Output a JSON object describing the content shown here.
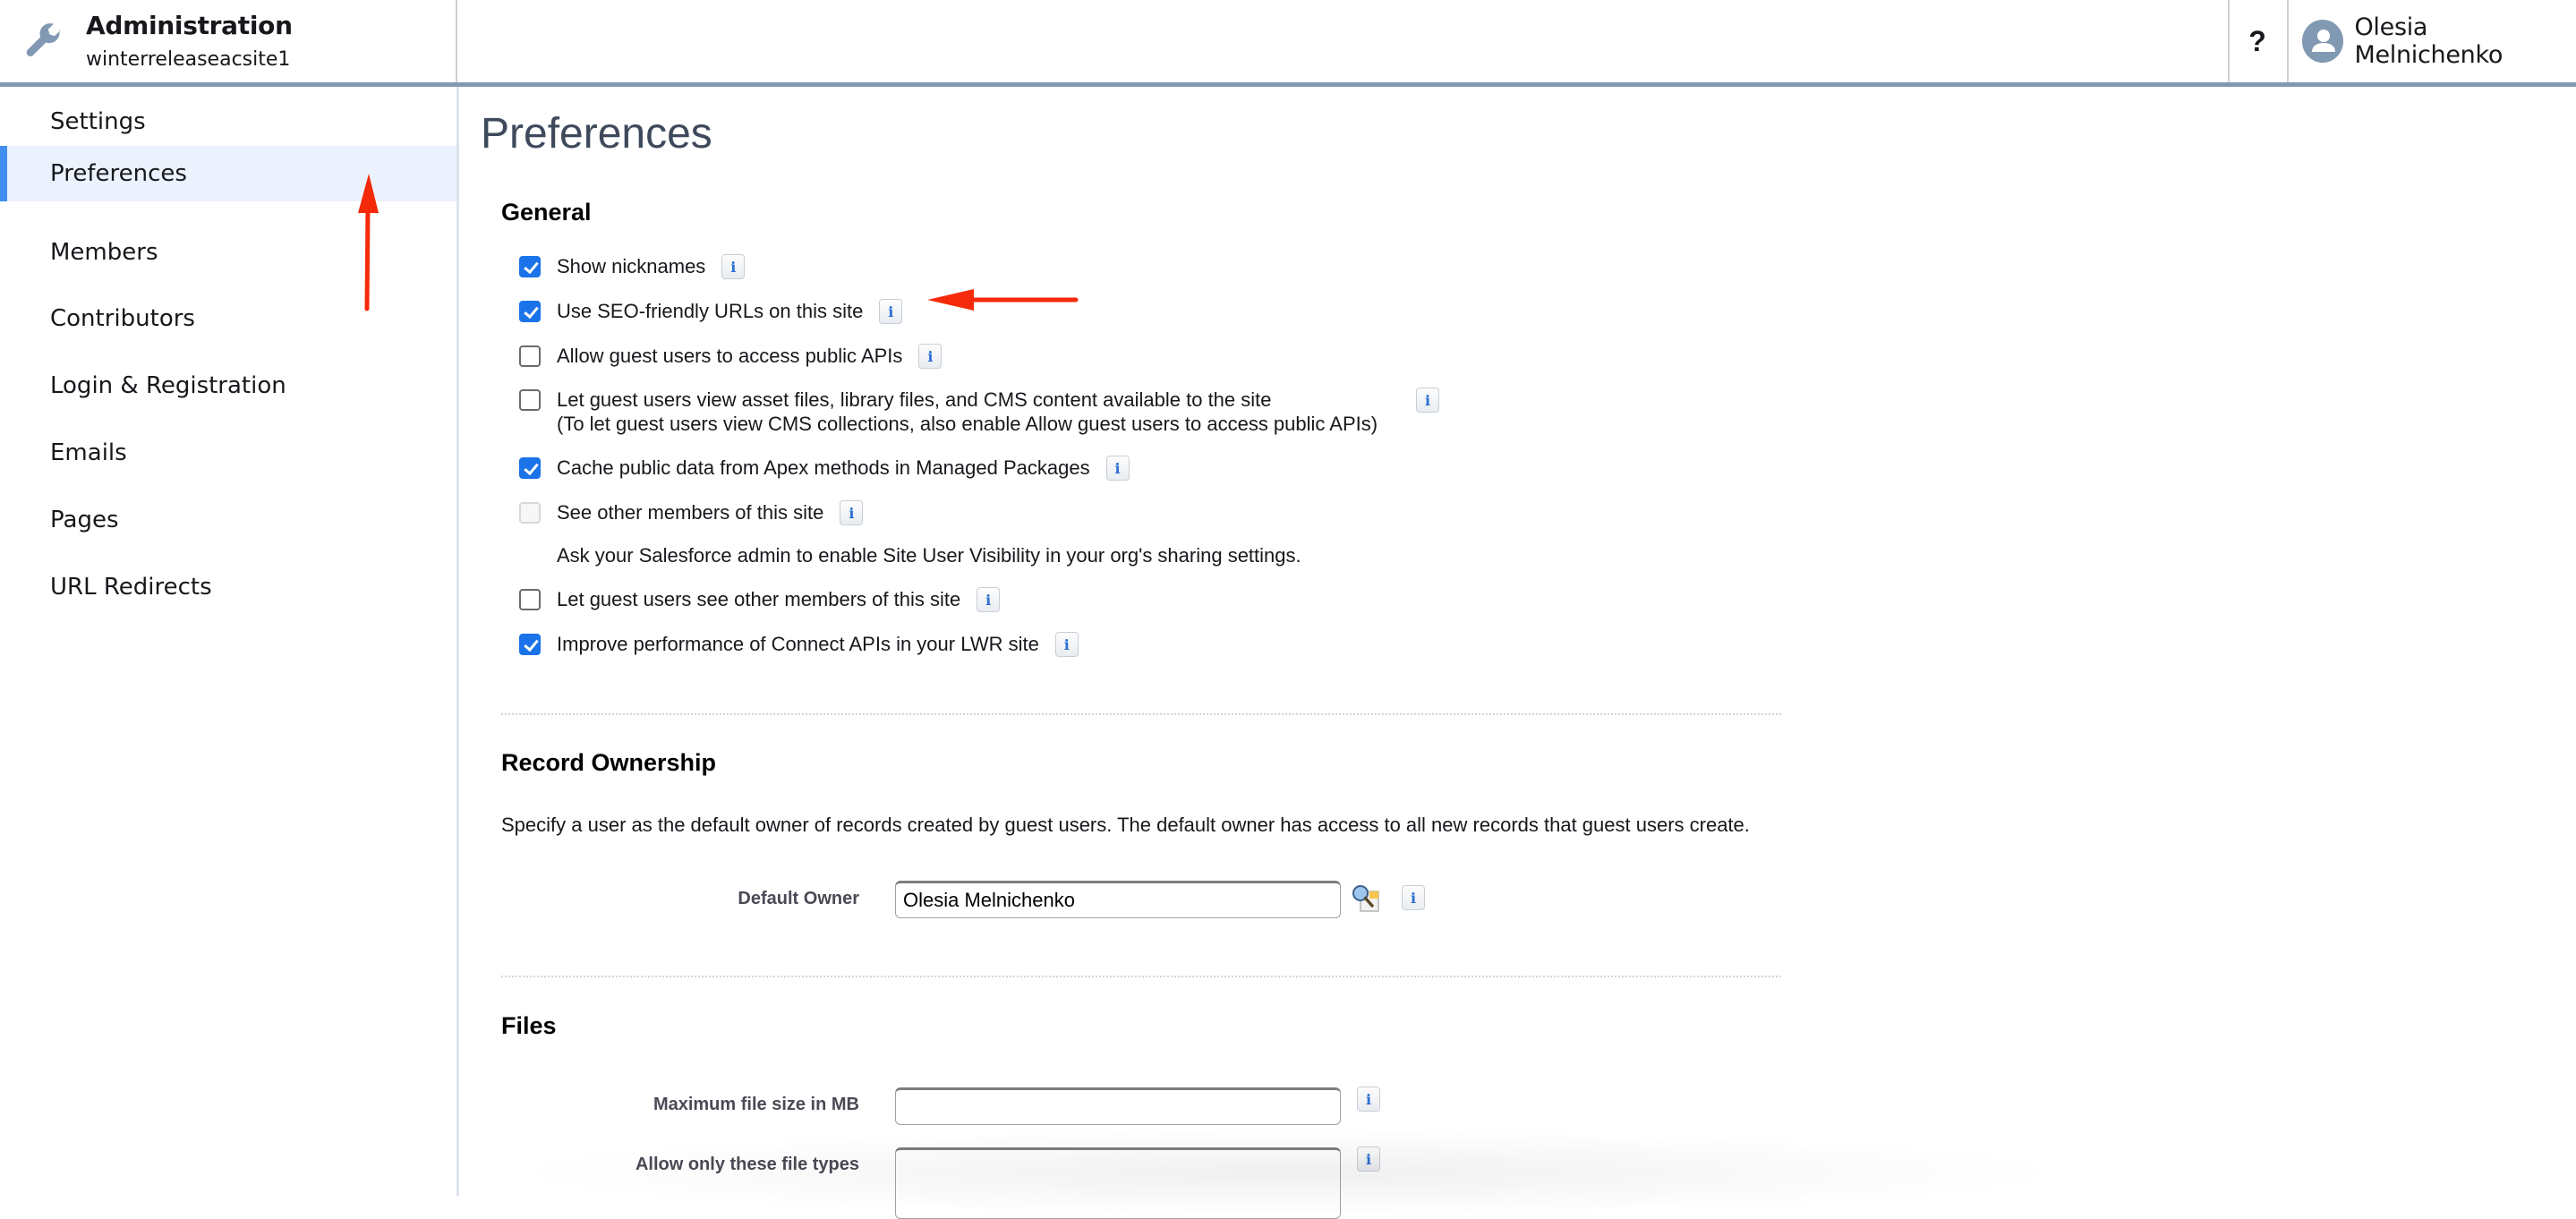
{
  "header": {
    "app_icon": "wrench-icon",
    "title": "Administration",
    "subtitle": "winterreleaseacsite1",
    "help_label": "?",
    "user_name": "Olesia Melnichenko"
  },
  "sidebar": {
    "items": [
      {
        "label": "Settings",
        "active": false
      },
      {
        "label": "Preferences",
        "active": true
      },
      {
        "label": "Members",
        "active": false
      },
      {
        "label": "Contributors",
        "active": false
      },
      {
        "label": "Login & Registration",
        "active": false
      },
      {
        "label": "Emails",
        "active": false
      },
      {
        "label": "Pages",
        "active": false
      },
      {
        "label": "URL Redirects",
        "active": false
      }
    ]
  },
  "main": {
    "title": "Preferences",
    "general": {
      "heading": "General",
      "options": [
        {
          "label": "Show nicknames",
          "checked": true,
          "disabled": false
        },
        {
          "label": "Use SEO-friendly URLs on this site",
          "checked": true,
          "disabled": false
        },
        {
          "label": "Allow guest users to access public APIs",
          "checked": false,
          "disabled": false
        },
        {
          "label": "Let guest users view asset files, library files, and CMS content available to the site",
          "label_line2": "(To let guest users view CMS collections, also enable Allow guest users to access public APIs)",
          "checked": false,
          "disabled": false
        },
        {
          "label": "Cache public data from Apex methods in Managed Packages",
          "checked": true,
          "disabled": false
        },
        {
          "label": "See other members of this site",
          "checked": false,
          "disabled": true
        },
        {
          "label": "Let guest users see other members of this site",
          "checked": false,
          "disabled": false
        },
        {
          "label": "Improve performance of Connect APIs in your LWR site",
          "checked": true,
          "disabled": false
        }
      ],
      "note": "Ask your Salesforce admin to enable Site User Visibility in your org's sharing settings."
    },
    "record_ownership": {
      "heading": "Record Ownership",
      "description": "Specify a user as the default owner of records created by guest users. The default owner has access to all new records that guest users create.",
      "default_owner_label": "Default Owner",
      "default_owner_value": "Olesia Melnichenko"
    },
    "files": {
      "heading": "Files",
      "max_size_label": "Maximum file size in MB",
      "max_size_value": "",
      "file_types_label": "Allow only these file types",
      "file_types_value": ""
    },
    "info_glyph": "i"
  },
  "annotations": {
    "arrow_color": "#f52a0a"
  }
}
